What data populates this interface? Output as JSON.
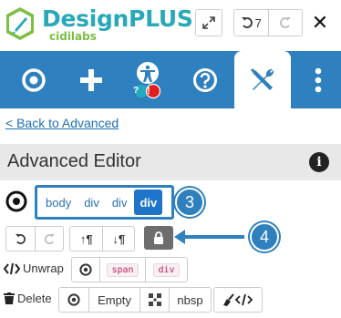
{
  "header": {
    "brand": "DesignPLUS",
    "brand_sub": "cidilabs",
    "undo_count": "7",
    "close": "✕"
  },
  "toolbar": {
    "items": [
      {
        "name": "target",
        "icon": "target-icon"
      },
      {
        "name": "add",
        "icon": "plus-icon"
      },
      {
        "name": "accessibility",
        "icon": "accessibility-icon",
        "badges": [
          "?",
          "!"
        ]
      },
      {
        "name": "help",
        "icon": "help-icon"
      },
      {
        "name": "tools",
        "icon": "wrench-screwdriver-icon",
        "active": true
      },
      {
        "name": "more",
        "icon": "vertical-ellipsis-icon"
      }
    ]
  },
  "back_link": "Back to Advanced",
  "section_title": "Advanced Editor",
  "info_glyph": "i",
  "breadcrumbs": [
    "body",
    "div",
    "div",
    "div"
  ],
  "callouts": {
    "first": "3",
    "second": "4"
  },
  "move_buttons": {
    "up_glyph": "↑¶",
    "down_glyph": "↓¶"
  },
  "unwrap": {
    "label": "Unwrap",
    "tags": [
      "span",
      "div"
    ]
  },
  "delete": {
    "label": "Delete",
    "empty": "Empty",
    "nbsp": "nbsp"
  },
  "colors": {
    "toolbar": "#2e80bf",
    "brand": "#29a8b8",
    "brand_sub": "#7bbf43",
    "active_crumb": "#1e74c8",
    "badge_help": "#26a9c0",
    "badge_alert": "#e01e1e"
  }
}
